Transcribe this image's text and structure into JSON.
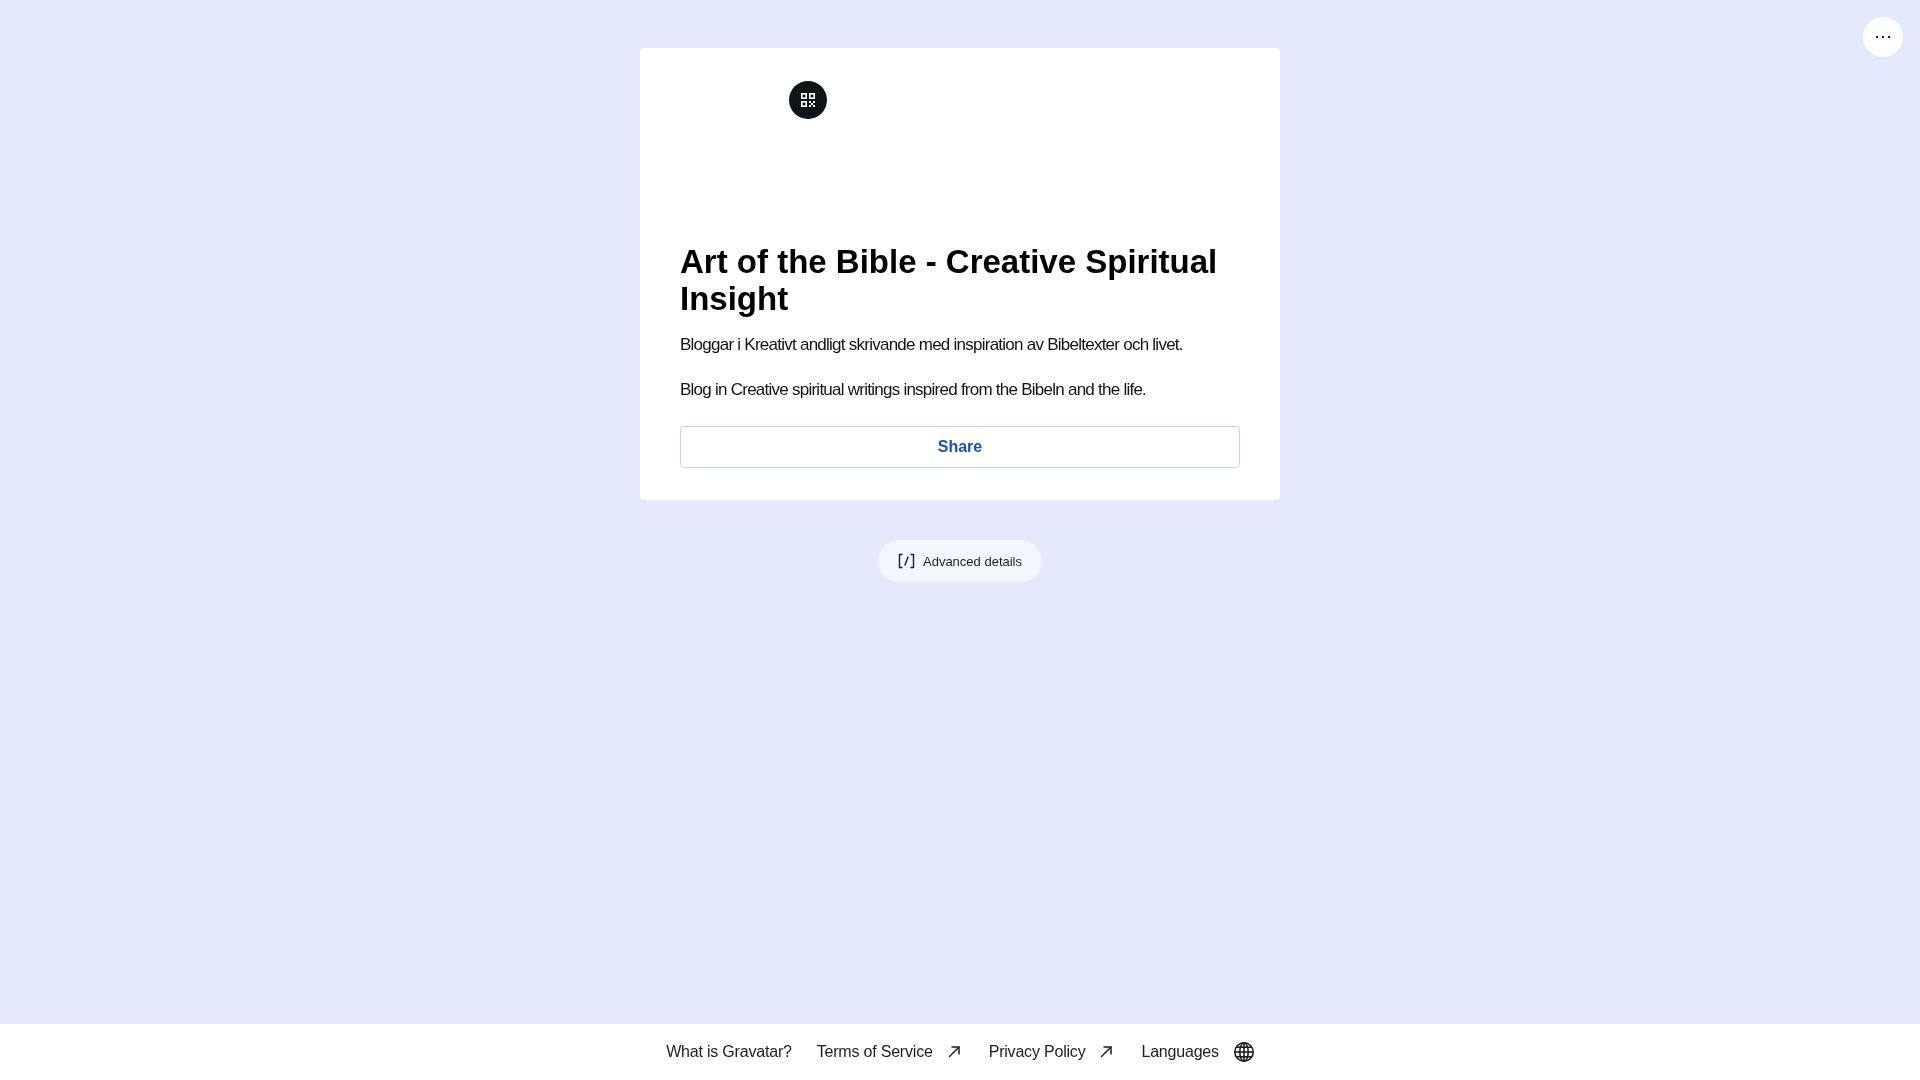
{
  "profile": {
    "title": "Art of the Bible - Creative Spiritual Insight",
    "description": [
      "Bloggar i Kreativt andligt skrivande med inspiration av Bibeltexter och livet.",
      "Blog in Creative spiritual writings inspired from the Bibeln and the life."
    ],
    "share_button": "Share"
  },
  "advanced_details": {
    "label": "Advanced details"
  },
  "footer": {
    "links": [
      {
        "label": "What is Gravatar?",
        "kind": "plain"
      },
      {
        "label": "Terms of Service",
        "kind": "external"
      },
      {
        "label": "Privacy Policy",
        "kind": "external"
      },
      {
        "label": "Languages",
        "kind": "language"
      }
    ]
  }
}
